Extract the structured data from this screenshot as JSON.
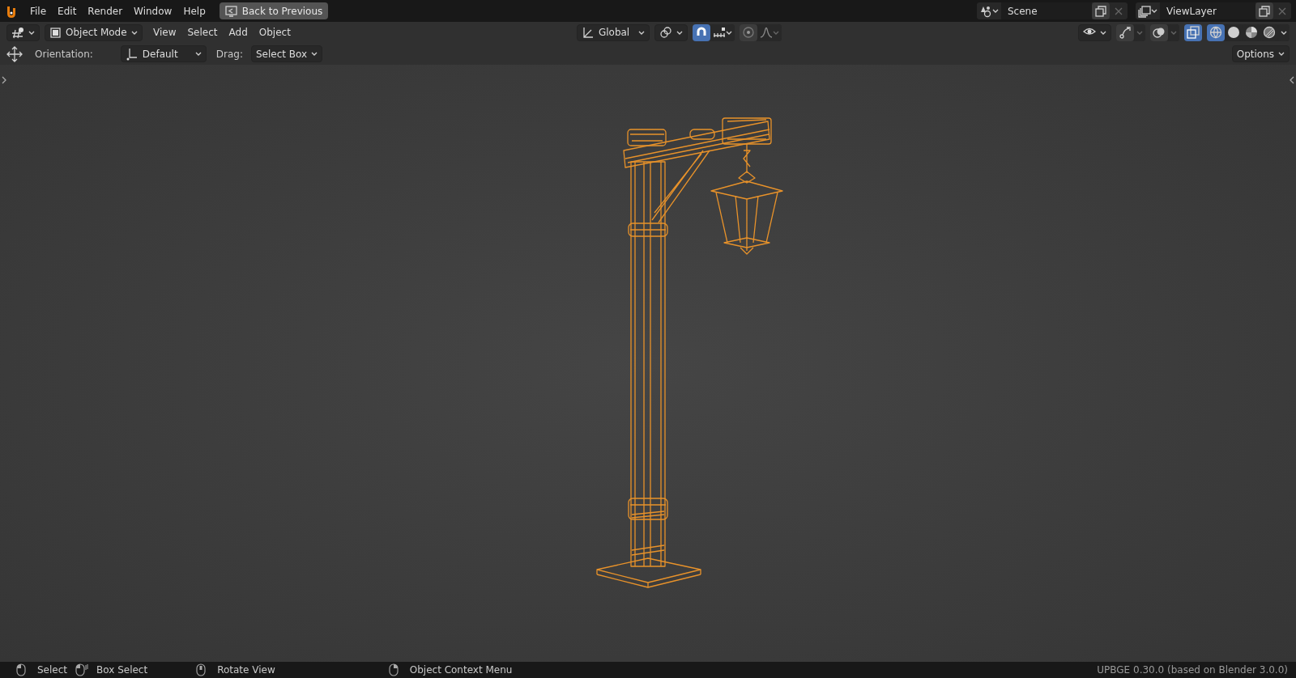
{
  "top_bar": {
    "menus": [
      "File",
      "Edit",
      "Render",
      "Window",
      "Help"
    ],
    "back_button": "Back to Previous",
    "scene": "Scene",
    "view_layer": "ViewLayer"
  },
  "viewport_header": {
    "mode": "Object Mode",
    "menus": [
      "View",
      "Select",
      "Add",
      "Object"
    ],
    "orientation": "Global",
    "snap_on": true,
    "xray_on": true,
    "shading": [
      {
        "kind": "wireframe",
        "selected": true
      },
      {
        "kind": "solid",
        "selected": false
      },
      {
        "kind": "material",
        "selected": false
      },
      {
        "kind": "rendered",
        "selected": false
      }
    ]
  },
  "tool_settings": {
    "orientation_label": "Orientation:",
    "orientation": "Default",
    "drag_label": "Drag:",
    "drag": "Select Box",
    "options": "Options"
  },
  "status_bar": {
    "hints": [
      {
        "kind": "left-click",
        "label": "Select"
      },
      {
        "kind": "left-drag",
        "label": "Box Select"
      },
      {
        "kind": "middle-click",
        "label": "Rotate View"
      },
      {
        "kind": "right-click",
        "label": "Object Context Menu"
      }
    ],
    "version": "UPBGE 0.30.0 (based on Blender 3.0.0)"
  }
}
